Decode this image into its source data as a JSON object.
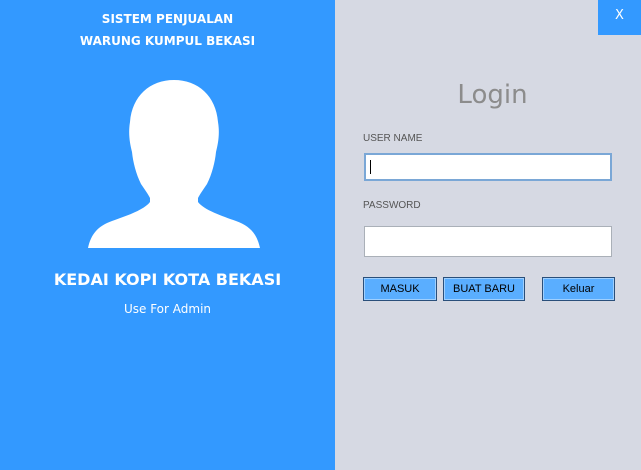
{
  "window": {
    "close_label": "X"
  },
  "left_panel": {
    "title_line1": "SISTEM PENJUALAN",
    "title_line2": "WARUNG KUMPUL BEKASI",
    "avatar_icon": "user-silhouette-icon",
    "store_name": "KEDAI KOPI KOTA BEKASI",
    "subtitle": "Use For Admin"
  },
  "login": {
    "heading": "Login",
    "username_label": "USER NAME",
    "username_value": "",
    "password_label": "PASSWORD",
    "password_value": "",
    "buttons": {
      "login": "MASUK",
      "register": "BUAT BARU",
      "exit": "Keluar"
    }
  },
  "colors": {
    "accent_blue": "#3399ff",
    "panel_gray": "#d6d9e3",
    "button_blue": "#5aaeff"
  }
}
